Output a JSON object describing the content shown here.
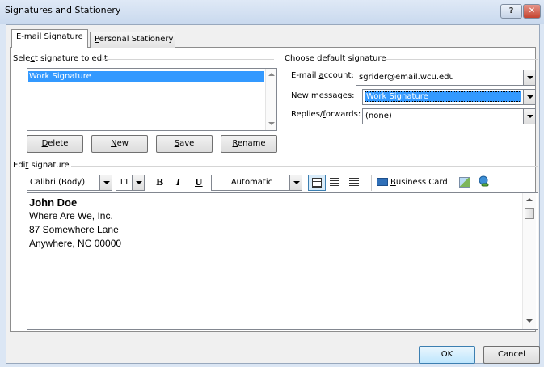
{
  "window": {
    "title": "Signatures and Stationery",
    "help": "?",
    "close": "✕"
  },
  "tabs": [
    {
      "key": "E",
      "rest": "-mail Signature"
    },
    {
      "key": "P",
      "rest": "ersonal Stationery"
    }
  ],
  "select_sig": {
    "label_a": "Sele",
    "key": "c",
    "label_b": "t signature to edit",
    "items": [
      "Work Signature"
    ]
  },
  "buttons": {
    "delete_key": "D",
    "delete_rest": "elete",
    "new_key": "N",
    "new_rest": "ew",
    "save_key": "S",
    "save_rest": "ave",
    "rename_key": "R",
    "rename_rest": "ename"
  },
  "default_sig": {
    "heading": "Choose default signature",
    "account_label_a": "E-mail ",
    "account_key": "a",
    "account_label_b": "ccount:",
    "account_value": "sgrider@email.wcu.edu",
    "newmsg_label_a": "New ",
    "newmsg_key": "m",
    "newmsg_label_b": "essages:",
    "newmsg_value": "Work Signature",
    "replies_label_a": "Replies/",
    "replies_key": "f",
    "replies_label_b": "orwards:",
    "replies_value": "(none)"
  },
  "edit_sig": {
    "label_a": "Edi",
    "key": "t",
    "label_b": " signature",
    "font": "Calibri (Body)",
    "size": "11",
    "bold": "B",
    "italic": "I",
    "underline": "U",
    "color": "Automatic",
    "business_card_key": "B",
    "business_card_rest": "usiness Card",
    "lines": [
      "John Doe",
      "Where Are We, Inc.",
      "87 Somewhere Lane",
      "Anywhere, NC 00000"
    ]
  },
  "footer": {
    "ok": "OK",
    "cancel": "Cancel"
  }
}
